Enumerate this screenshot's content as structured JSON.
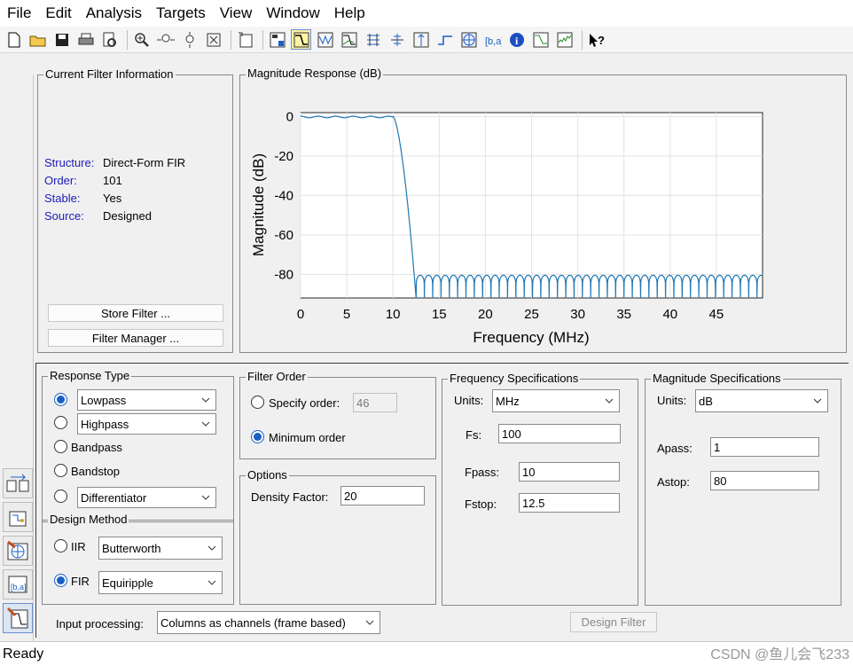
{
  "menu": [
    "File",
    "Edit",
    "Analysis",
    "Targets",
    "View",
    "Window",
    "Help"
  ],
  "toolbar_icons": [
    "new-icon",
    "open-icon",
    "save-icon",
    "print-icon",
    "print-preview-icon",
    "zoom-in-icon",
    "zoom-x-icon",
    "zoom-y-icon",
    "full-view-icon",
    "new-window-icon",
    "filter-info-icon",
    "magnitude-response-icon",
    "phase-response-icon",
    "mag-phase-icon",
    "group-delay-icon",
    "phase-delay-icon",
    "impulse-response-icon",
    "step-response-icon",
    "pole-zero-icon",
    "coefficients-icon",
    "info-icon",
    "magnitude-estimate-icon",
    "noise-power-icon",
    "whats-this-icon"
  ],
  "filter_info": {
    "title": "Current Filter Information",
    "rows": [
      {
        "key": "Structure:",
        "value": "Direct-Form FIR"
      },
      {
        "key": "Order:",
        "value": "101"
      },
      {
        "key": "Stable:",
        "value": "Yes"
      },
      {
        "key": "Source:",
        "value": "Designed"
      }
    ],
    "store_button": "Store Filter ...",
    "manager_button": "Filter Manager ..."
  },
  "plot_panel": {
    "title": "Magnitude Response (dB)"
  },
  "chart_data": {
    "type": "line",
    "title": "",
    "xlabel": "Frequency (MHz)",
    "ylabel": "Magnitude (dB)",
    "xlim": [
      0,
      50
    ],
    "ylim": [
      -92,
      2
    ],
    "xticks": [
      0,
      5,
      10,
      15,
      20,
      25,
      30,
      35,
      40,
      45
    ],
    "yticks": [
      0,
      -20,
      -40,
      -60,
      -80
    ],
    "grid": true,
    "series": [
      {
        "color": "#1f77b4",
        "passband_edge_mhz": 10,
        "stopband_edge_mhz": 12.5,
        "passband_ripple_db": 1,
        "stopband_floor_db": -80,
        "x": [
          0,
          10,
          10.5,
          11,
          11.5,
          12,
          12.5,
          50
        ],
        "y": [
          0,
          -0.5,
          -10,
          -28,
          -50,
          -70,
          -92,
          -80
        ]
      }
    ]
  },
  "response_type": {
    "title": "Response Type",
    "options": [
      {
        "label": "Lowpass",
        "selected": true,
        "has_dropdown": true
      },
      {
        "label": "Highpass",
        "selected": false,
        "has_dropdown": true
      },
      {
        "label": "Bandpass",
        "selected": false,
        "has_dropdown": false
      },
      {
        "label": "Bandstop",
        "selected": false,
        "has_dropdown": false
      },
      {
        "label": "Differentiator",
        "selected": false,
        "has_dropdown": true
      }
    ]
  },
  "design_method": {
    "title": "Design Method",
    "iir_label": "IIR",
    "iir_value": "Butterworth",
    "fir_label": "FIR",
    "fir_value": "Equiripple",
    "selected": "FIR"
  },
  "filter_order": {
    "title": "Filter Order",
    "specify_label": "Specify order:",
    "specify_value": "46",
    "minimum_label": "Minimum order",
    "selected": "minimum"
  },
  "options": {
    "title": "Options",
    "density_label": "Density Factor:",
    "density_value": "20"
  },
  "freq_specs": {
    "title": "Frequency Specifications",
    "units_label": "Units:",
    "units_value": "MHz",
    "fs_label": "Fs:",
    "fs_value": "100",
    "fpass_label": "Fpass:",
    "fpass_value": "10",
    "fstop_label": "Fstop:",
    "fstop_value": "12.5"
  },
  "mag_specs": {
    "title": "Magnitude Specifications",
    "units_label": "Units:",
    "units_value": "dB",
    "apass_label": "Apass:",
    "apass_value": "1",
    "astop_label": "Astop:",
    "astop_value": "80"
  },
  "input_processing": {
    "label": "Input processing:",
    "value": "Columns as channels (frame based)"
  },
  "design_button": "Design Filter",
  "status": "Ready",
  "watermark": "CSDN @鱼儿会飞233"
}
